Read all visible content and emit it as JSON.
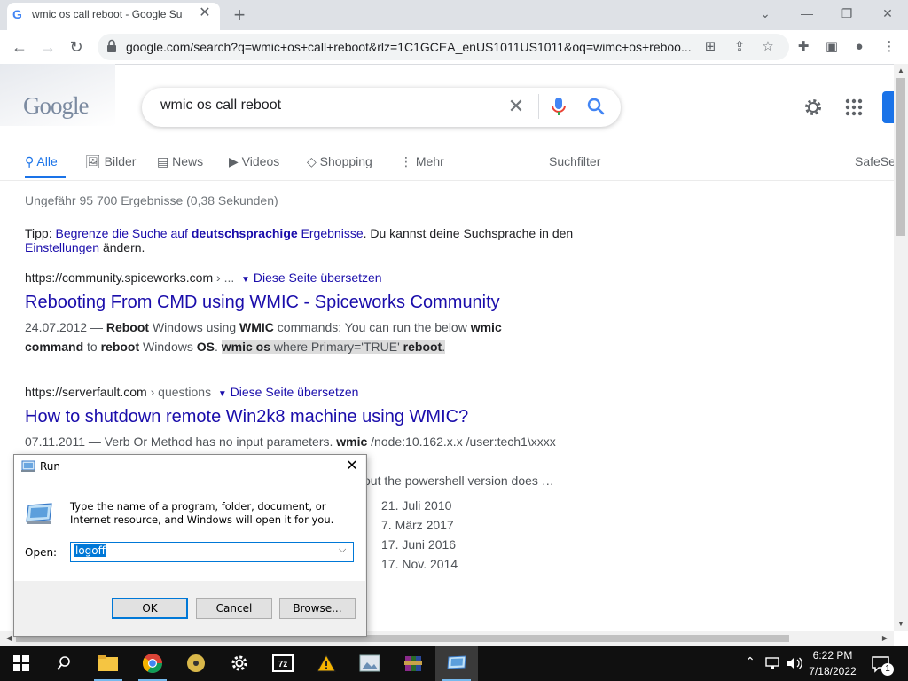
{
  "browser": {
    "tab_title": "wmic os call reboot - Google Su",
    "url": "google.com/search?q=wmic+os+call+reboot&rlz=1C1GCEA_enUS1011US1011&oq=wimc+os+reboo..."
  },
  "google": {
    "logo": "Google",
    "query": "wmic os call reboot",
    "tabs": [
      "Alle",
      "Bilder",
      "News",
      "Videos",
      "Shopping",
      "Mehr"
    ],
    "filter": "Suchfilter",
    "safesearch": "SafeSe",
    "stats": "Ungefähr 95 700 Ergebnisse (0,38 Sekunden)",
    "tip": {
      "prefix": "Tipp: ",
      "link1": "Begrenze die Suche auf ",
      "bold": "deutschsprachige",
      "link1b": " Ergebnisse",
      "mid": ". Du kannst deine Suchsprache in den ",
      "link2": "Einstellungen",
      "suffix": " ändern."
    },
    "results": [
      {
        "cite_domain": "https://community.spiceworks.com",
        "cite_path": " › ...",
        "translate": "Diese Seite übersetzen",
        "title": "Rebooting From CMD using WMIC - Spiceworks Community",
        "date": "24.07.2012 — ",
        "snippet_line1_a": "Reboot",
        "snippet_line1_b": " Windows using ",
        "snippet_line1_c": "WMIC",
        "snippet_line1_d": " commands: You can run the below ",
        "snippet_line1_e": "wmic",
        "snippet_line2_a": "command",
        "snippet_line2_b": " to ",
        "snippet_line2_c": "reboot",
        "snippet_line2_d": " Windows ",
        "snippet_line2_e": "OS",
        "snippet_line2_f": ". ",
        "snippet_hl_a": "wmic os",
        "snippet_hl_b": " where Primary='TRUE' ",
        "snippet_hl_c": "reboot",
        "snippet_hl_d": "."
      },
      {
        "cite_domain": "https://serverfault.com",
        "cite_path": " › questions",
        "translate": "Diese Seite übersetzen",
        "title": "How to shutdown remote Win2k8 machine using WMIC?",
        "date": "07.11.2011 — ",
        "snippet_line1": "Verb Or Method has no input parameters. ",
        "snippet_line1_b": "wmic",
        "snippet_line1_c": " /node:10.162.x.x /user:tech1\\xxxx",
        "snippet_line2": "out the powershell version does …",
        "dates": [
          "21. Juli 2010",
          "7. März 2017",
          "17. Juni 2016",
          "17. Nov. 2014"
        ]
      }
    ]
  },
  "run_dialog": {
    "title": "Run",
    "description": "Type the name of a program, folder, document, or Internet resource, and Windows will open it for you.",
    "open_label": "Open:",
    "open_value": "logoff",
    "ok": "OK",
    "cancel": "Cancel",
    "browse": "Browse..."
  },
  "taskbar": {
    "time": "6:22 PM",
    "date": "7/18/2022",
    "notification_count": "1"
  }
}
